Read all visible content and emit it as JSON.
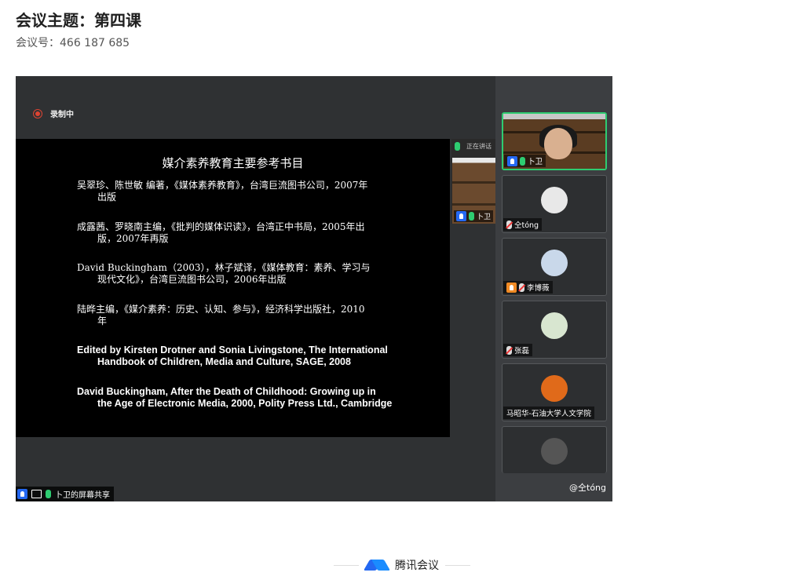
{
  "header": {
    "title": "会议主题：第四课",
    "meeting_id": "会议号：466 187 685"
  },
  "recording": {
    "label": "录制中",
    "color": "#dd4433"
  },
  "slide": {
    "title": "媒介素养教育主要参考书目",
    "refs": [
      {
        "line1": "吴翠珍、陈世敏 编著，《媒体素养教育》，台湾巨流图书公司，2007年",
        "line2": "出版"
      },
      {
        "line1": "成露茜、罗晓南主编，《批判的媒体识读》，台湾正中书局，2005年出",
        "line2": "版，2007年再版"
      },
      {
        "line1": "David Buckingham（2003），林子斌译，《媒体教育：素养、学习与",
        "line2": "现代文化》，台湾巨流图书公司，2006年出版"
      },
      {
        "line1": "陆晔主编，《媒介素养：历史、认知、参与》，经济科学出版社，2010",
        "line2": "年"
      },
      {
        "line1": "Edited by Kirsten Drotner and Sonia Livingstone, The International",
        "line2": "Handbook of Children, Media and Culture, SAGE, 2008"
      },
      {
        "line1": "David Buckingham, After the Death of Childhood: Growing up in",
        "line2": "the Age of Electronic Media, 2000, Polity Press Ltd., Cambridge"
      }
    ]
  },
  "inner_strip": {
    "speaking_label": "正在讲话",
    "name": "卜卫"
  },
  "participants": [
    {
      "name": "卜卫",
      "active": true,
      "mic": "on",
      "icon": "user-icon"
    },
    {
      "name": "仝tóng",
      "active": false,
      "mic": "muted",
      "icon": ""
    },
    {
      "name": "李博薇",
      "active": false,
      "mic": "muted",
      "icon": "user-icon"
    },
    {
      "name": "张磊",
      "active": false,
      "mic": "muted",
      "icon": ""
    },
    {
      "name": "马昭华-石油大学人文学院",
      "active": false,
      "mic": "none",
      "icon": ""
    },
    {
      "name": "",
      "active": false,
      "mic": "none",
      "icon": ""
    }
  ],
  "share_label": "卜卫的屏幕共享",
  "mention": "@仝tóng",
  "footer": {
    "brand": "腾讯会议"
  },
  "colors": {
    "accent": "#2468f2",
    "speaking": "#2ecc71",
    "muted": "#e33333"
  }
}
